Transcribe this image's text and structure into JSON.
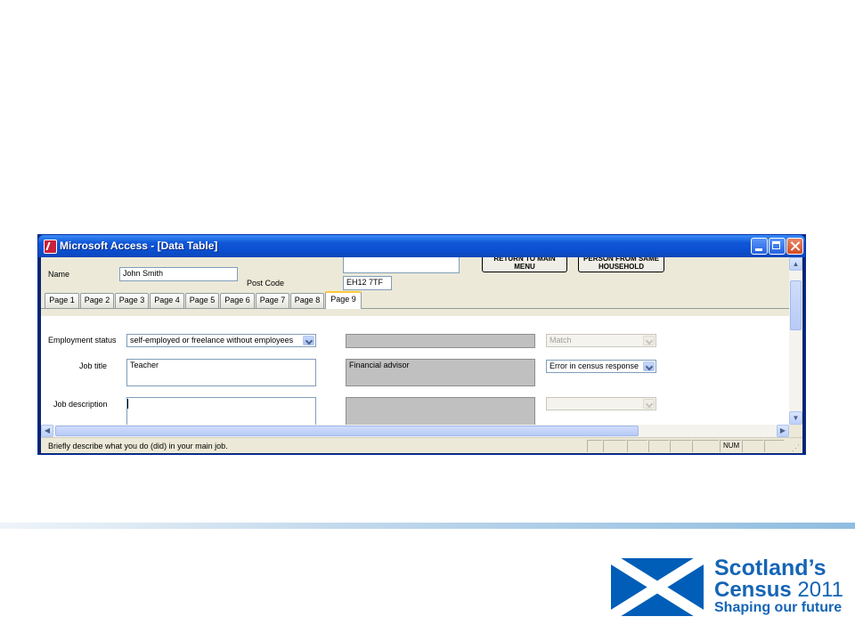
{
  "window": {
    "title": "Microsoft Access - [Data Table]"
  },
  "form": {
    "name_label": "Name",
    "name_value": "John Smith",
    "postcode_label": "Post Code",
    "postcode_value": "EH12 7TF",
    "top_field_value": "",
    "buttons": {
      "return_menu": "RETURN TO MAIN MENU",
      "person_same_household": "PERSON FROM SAME HOUSEHOLD"
    }
  },
  "tabs": [
    {
      "label": "Page 1"
    },
    {
      "label": "Page 2"
    },
    {
      "label": "Page 3"
    },
    {
      "label": "Page 4"
    },
    {
      "label": "Page 5"
    },
    {
      "label": "Page 6"
    },
    {
      "label": "Page 7"
    },
    {
      "label": "Page 8"
    },
    {
      "label": "Page 9",
      "active": true
    }
  ],
  "page9": {
    "employment_status_label": "Employment status",
    "employment_status_value": "self-employed or freelance without employees",
    "employment_coded_value": "",
    "employment_match_value": "Match",
    "job_title_label": "Job title",
    "job_title_value": "Teacher",
    "job_title_coded_value": "Financial advisor",
    "job_title_match_value": "Error in census response",
    "job_description_label": "Job description",
    "job_description_value": "",
    "job_description_coded_value": "",
    "job_description_match_value": ""
  },
  "statusbar": {
    "message": "Briefly describe what you do (did) in your main job.",
    "num_indicator": "NUM"
  },
  "logo": {
    "line1": "Scotland’s",
    "line2_word": "Census",
    "line2_year": "2011",
    "line3": "Shaping our future"
  },
  "colors": {
    "title_bar": "#0a4fd0",
    "form_background": "#ece9d8",
    "active_tab_highlight": "#ffc83c",
    "coded_field_gray": "#c0c0c0",
    "logo_blue": "#005eb8",
    "logo_text": "#1565b5"
  }
}
